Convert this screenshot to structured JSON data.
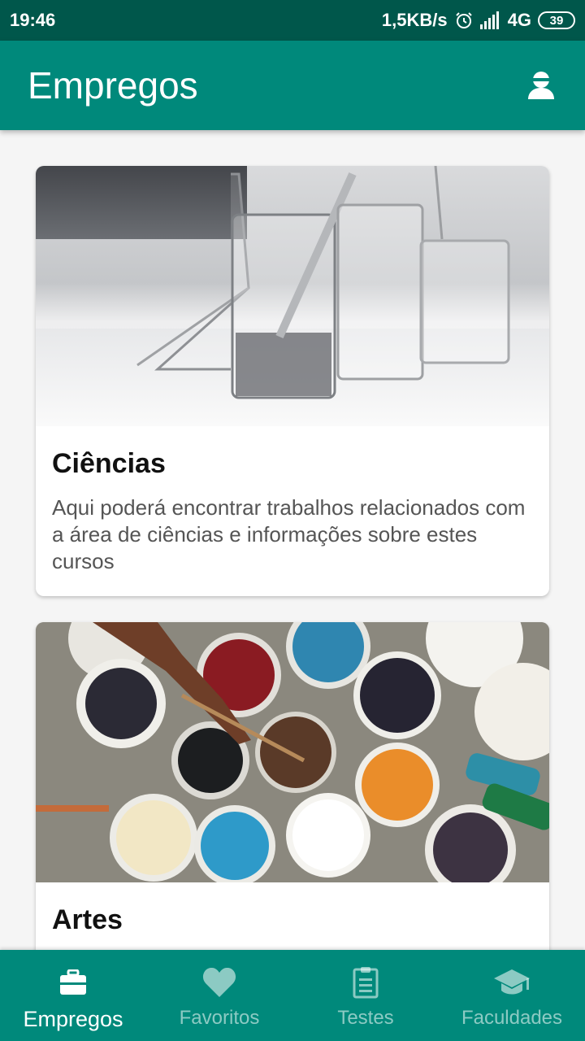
{
  "status_bar": {
    "time": "19:46",
    "speed": "1,5KB/s",
    "network": "4G",
    "battery": "39"
  },
  "app_bar": {
    "title": "Empregos"
  },
  "cards": [
    {
      "title": "Ciências",
      "description": "Aqui poderá encontrar trabalhos relacionados com a área de ciências e informações sobre estes cursos",
      "image": "laboratory-glassware-photo"
    },
    {
      "title": "Artes",
      "description": "",
      "image": "paint-buckets-photo"
    }
  ],
  "bottom_nav": {
    "items": [
      {
        "label": "Empregos",
        "icon": "briefcase-icon",
        "active": true
      },
      {
        "label": "Favoritos",
        "icon": "heart-icon",
        "active": false
      },
      {
        "label": "Testes",
        "icon": "clipboard-icon",
        "active": false
      },
      {
        "label": "Faculdades",
        "icon": "graduation-cap-icon",
        "active": false
      }
    ]
  },
  "colors": {
    "primary": "#00897b",
    "primary_dark": "#00574b",
    "background": "#f5f5f5"
  }
}
